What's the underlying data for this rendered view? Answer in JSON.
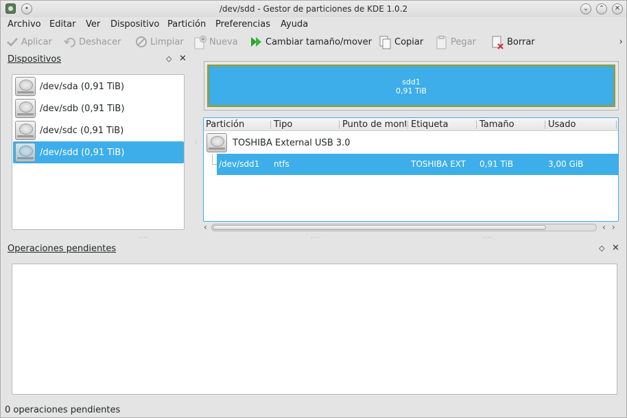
{
  "window": {
    "title": "/dev/sdd - Gestor de particiones de KDE 1.0.2"
  },
  "menu": {
    "archivo": "Archivo",
    "editar": "Editar",
    "ver": "Ver",
    "dispositivo": "Dispositivo",
    "particion": "Partición",
    "preferencias": "Preferencias",
    "ayuda": "Ayuda"
  },
  "toolbar": {
    "aplicar": "Aplicar",
    "deshacer": "Deshacer",
    "limpiar": "Limpiar",
    "nueva": "Nueva",
    "cambiar": "Cambiar tamaño/mover",
    "copiar": "Copiar",
    "pegar": "Pegar",
    "borrar": "Borrar",
    "more": "›"
  },
  "devices_panel": {
    "title": "Dispositivos",
    "items": [
      {
        "label": "/dev/sda (0,91 TiB)",
        "selected": false
      },
      {
        "label": "/dev/sdb (0,91 TiB)",
        "selected": false
      },
      {
        "label": "/dev/sdc (0,91 TiB)",
        "selected": false
      },
      {
        "label": "/dev/sdd (0,91 TiB)",
        "selected": true
      }
    ]
  },
  "graphic": {
    "name": "sdd1",
    "size": "0,91 TiB",
    "accent": "#3daee9"
  },
  "partition_table": {
    "headers": [
      "Partición",
      "Tipo",
      "Punto de mont",
      "Etiqueta",
      "Tamaño",
      "Usado"
    ],
    "device_row": "TOSHIBA External USB 3.0",
    "rows": [
      {
        "particion": "/dev/sdd1",
        "tipo": "ntfs",
        "punto": "",
        "etiqueta": "TOSHIBA EXT",
        "tamano": "0,91 TiB",
        "usado": "3,00 GiB"
      }
    ]
  },
  "pending_panel": {
    "title": "Operaciones pendientes"
  },
  "statusbar": {
    "text": "0 operaciones pendientes"
  }
}
